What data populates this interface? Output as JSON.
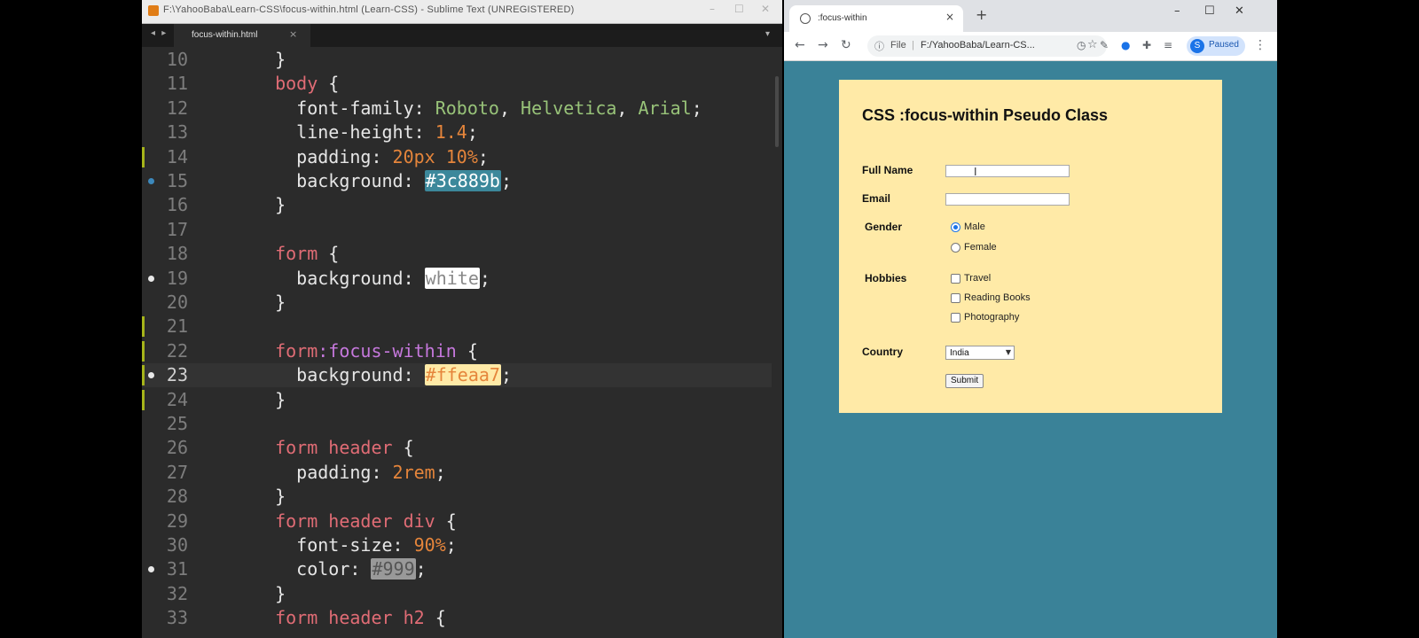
{
  "editor": {
    "title": "F:\\YahooBaba\\Learn-CSS\\focus-within.html (Learn-CSS) - Sublime Text (UNREGISTERED)",
    "tab_label": "focus-within.html",
    "tab_close": "×",
    "tab_nav": "◂ ▸",
    "tab_dropdown": "▾",
    "window_controls": {
      "minimize": "–",
      "maximize": "☐",
      "close": "✕"
    },
    "active_line": "23",
    "lines": [
      {
        "n": "10",
        "tokens": [
          {
            "t": "plain",
            "v": "  }"
          }
        ]
      },
      {
        "n": "11",
        "tokens": [
          {
            "t": "sel",
            "v": "  body"
          },
          {
            "t": "plain",
            "v": " {"
          }
        ]
      },
      {
        "n": "12",
        "tokens": [
          {
            "t": "prop",
            "v": "    font-family: "
          },
          {
            "t": "str",
            "v": "Roboto"
          },
          {
            "t": "plain",
            "v": ", "
          },
          {
            "t": "str",
            "v": "Helvetica"
          },
          {
            "t": "plain",
            "v": ", "
          },
          {
            "t": "str",
            "v": "Arial"
          },
          {
            "t": "plain",
            "v": ";"
          }
        ]
      },
      {
        "n": "13",
        "tokens": [
          {
            "t": "prop",
            "v": "    line-height: "
          },
          {
            "t": "num",
            "v": "1.4"
          },
          {
            "t": "plain",
            "v": ";"
          }
        ]
      },
      {
        "n": "14",
        "mark": true,
        "tokens": [
          {
            "t": "prop",
            "v": "    padding: "
          },
          {
            "t": "num",
            "v": "20px 10%"
          },
          {
            "t": "plain",
            "v": ";"
          }
        ]
      },
      {
        "n": "15",
        "dot": "blue",
        "tokens": [
          {
            "t": "prop",
            "v": "    background: "
          },
          {
            "t": "col1",
            "v": "#3c889b"
          },
          {
            "t": "plain",
            "v": ";"
          }
        ]
      },
      {
        "n": "16",
        "tokens": [
          {
            "t": "plain",
            "v": "  }"
          }
        ]
      },
      {
        "n": "17",
        "tokens": []
      },
      {
        "n": "18",
        "tokens": [
          {
            "t": "sel",
            "v": "  form"
          },
          {
            "t": "plain",
            "v": " {"
          }
        ]
      },
      {
        "n": "19",
        "dot": "white",
        "tokens": [
          {
            "t": "prop",
            "v": "    background: "
          },
          {
            "t": "col2",
            "v": "white"
          },
          {
            "t": "plain",
            "v": ";"
          }
        ]
      },
      {
        "n": "20",
        "tokens": [
          {
            "t": "plain",
            "v": "  }"
          }
        ]
      },
      {
        "n": "21",
        "mark": true,
        "tokens": []
      },
      {
        "n": "22",
        "mark": true,
        "tokens": [
          {
            "t": "sel",
            "v": "  form"
          },
          {
            "t": "pseudo",
            "v": ":focus-within"
          },
          {
            "t": "plain",
            "v": " {"
          }
        ]
      },
      {
        "n": "23",
        "mark": true,
        "dot": "white",
        "tokens": [
          {
            "t": "prop",
            "v": "    background: "
          },
          {
            "t": "col3",
            "v": "#ffeaa7"
          },
          {
            "t": "plain",
            "v": ";"
          }
        ]
      },
      {
        "n": "24",
        "mark": true,
        "tokens": [
          {
            "t": "plain",
            "v": "  }"
          }
        ]
      },
      {
        "n": "25",
        "tokens": []
      },
      {
        "n": "26",
        "tokens": [
          {
            "t": "sel",
            "v": "  form header"
          },
          {
            "t": "plain",
            "v": " {"
          }
        ]
      },
      {
        "n": "27",
        "tokens": [
          {
            "t": "prop",
            "v": "    padding: "
          },
          {
            "t": "num",
            "v": "2rem"
          },
          {
            "t": "plain",
            "v": ";"
          }
        ]
      },
      {
        "n": "28",
        "tokens": [
          {
            "t": "plain",
            "v": "  }"
          }
        ]
      },
      {
        "n": "29",
        "tokens": [
          {
            "t": "sel",
            "v": "  form header div"
          },
          {
            "t": "plain",
            "v": " {"
          }
        ]
      },
      {
        "n": "30",
        "tokens": [
          {
            "t": "prop",
            "v": "    font-size: "
          },
          {
            "t": "num",
            "v": "90%"
          },
          {
            "t": "plain",
            "v": ";"
          }
        ]
      },
      {
        "n": "31",
        "dot": "white",
        "tokens": [
          {
            "t": "prop",
            "v": "    color: "
          },
          {
            "t": "col4",
            "v": "#999"
          },
          {
            "t": "plain",
            "v": ";"
          }
        ]
      },
      {
        "n": "32",
        "tokens": [
          {
            "t": "plain",
            "v": "  }"
          }
        ]
      },
      {
        "n": "33",
        "tokens": [
          {
            "t": "sel",
            "v": "  form header h2"
          },
          {
            "t": "plain",
            "v": " {"
          }
        ]
      }
    ]
  },
  "browser": {
    "tab_title": ":focus-within",
    "tab_close": "×",
    "new_tab": "+",
    "window_controls": {
      "minimize": "–",
      "maximize": "☐",
      "close": "✕"
    },
    "nav": {
      "back": "←",
      "forward": "→",
      "reload": "↻"
    },
    "omnibox": {
      "scheme": "File",
      "url": "F:/YahooBaba/Learn-CS...",
      "info_icon": "ⓘ",
      "star": "☆"
    },
    "toolbar_icons": [
      "◷",
      "✎",
      "●",
      "✚",
      "≡"
    ],
    "profile": {
      "initial": "S",
      "label": "Paused"
    },
    "menu": "⋮",
    "page_background": "#3a8298"
  },
  "form": {
    "background": "#ffeaa7",
    "title": "CSS :focus-within Pseudo Class",
    "full_name_label": "Full Name",
    "full_name_value": "",
    "email_label": "Email",
    "email_value": "",
    "gender_label": "Gender",
    "gender_options": [
      "Male",
      "Female"
    ],
    "gender_selected": "Male",
    "hobbies_label": "Hobbies",
    "hobbies_options": [
      "Travel",
      "Reading Books",
      "Photography"
    ],
    "country_label": "Country",
    "country_value": "India",
    "submit_label": "Submit"
  }
}
